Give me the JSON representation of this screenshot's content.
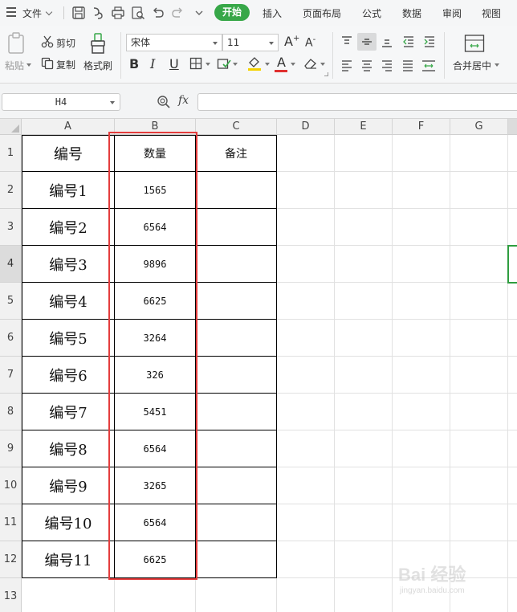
{
  "menubar": {
    "file_label": "文件",
    "tabs": [
      "开始",
      "插入",
      "页面布局",
      "公式",
      "数据",
      "审阅",
      "视图"
    ],
    "active_tab": "开始"
  },
  "ribbon": {
    "paste_label": "粘贴",
    "cut_label": "剪切",
    "copy_label": "复制",
    "format_painter_label": "格式刷",
    "font_name": "宋体",
    "font_size": "11",
    "increase_font": "A",
    "decrease_font": "A",
    "bold": "B",
    "italic": "I",
    "underline": "U",
    "font_color_letter": "A",
    "merge_center_label": "合并居中"
  },
  "formula_bar": {
    "name_box": "H4",
    "fx_label": "fx",
    "formula": ""
  },
  "sheet": {
    "col_headers": [
      "A",
      "B",
      "C",
      "D",
      "E",
      "F",
      "G"
    ],
    "row_headers": [
      "1",
      "2",
      "3",
      "4",
      "5",
      "6",
      "7",
      "8",
      "9",
      "10",
      "11",
      "12",
      "13"
    ],
    "header_row": [
      "编号",
      "数量",
      "备注"
    ],
    "rows": [
      [
        "编号1",
        "1565",
        ""
      ],
      [
        "编号2",
        "6564",
        ""
      ],
      [
        "编号3",
        "9896",
        ""
      ],
      [
        "编号4",
        "6625",
        ""
      ],
      [
        "编号5",
        "3264",
        ""
      ],
      [
        "编号6",
        "326",
        ""
      ],
      [
        "编号7",
        "5451",
        ""
      ],
      [
        "编号8",
        "6564",
        ""
      ],
      [
        "编号9",
        "3265",
        ""
      ],
      [
        "编号10",
        "6564",
        ""
      ],
      [
        "编号11",
        "6625",
        ""
      ]
    ],
    "active_row": "4",
    "selection_color": "#2e9d3f",
    "highlight_color": "#e43d3d"
  },
  "watermark": {
    "line1": "Bai 经验",
    "line2": "jingyan.baidu.com"
  }
}
